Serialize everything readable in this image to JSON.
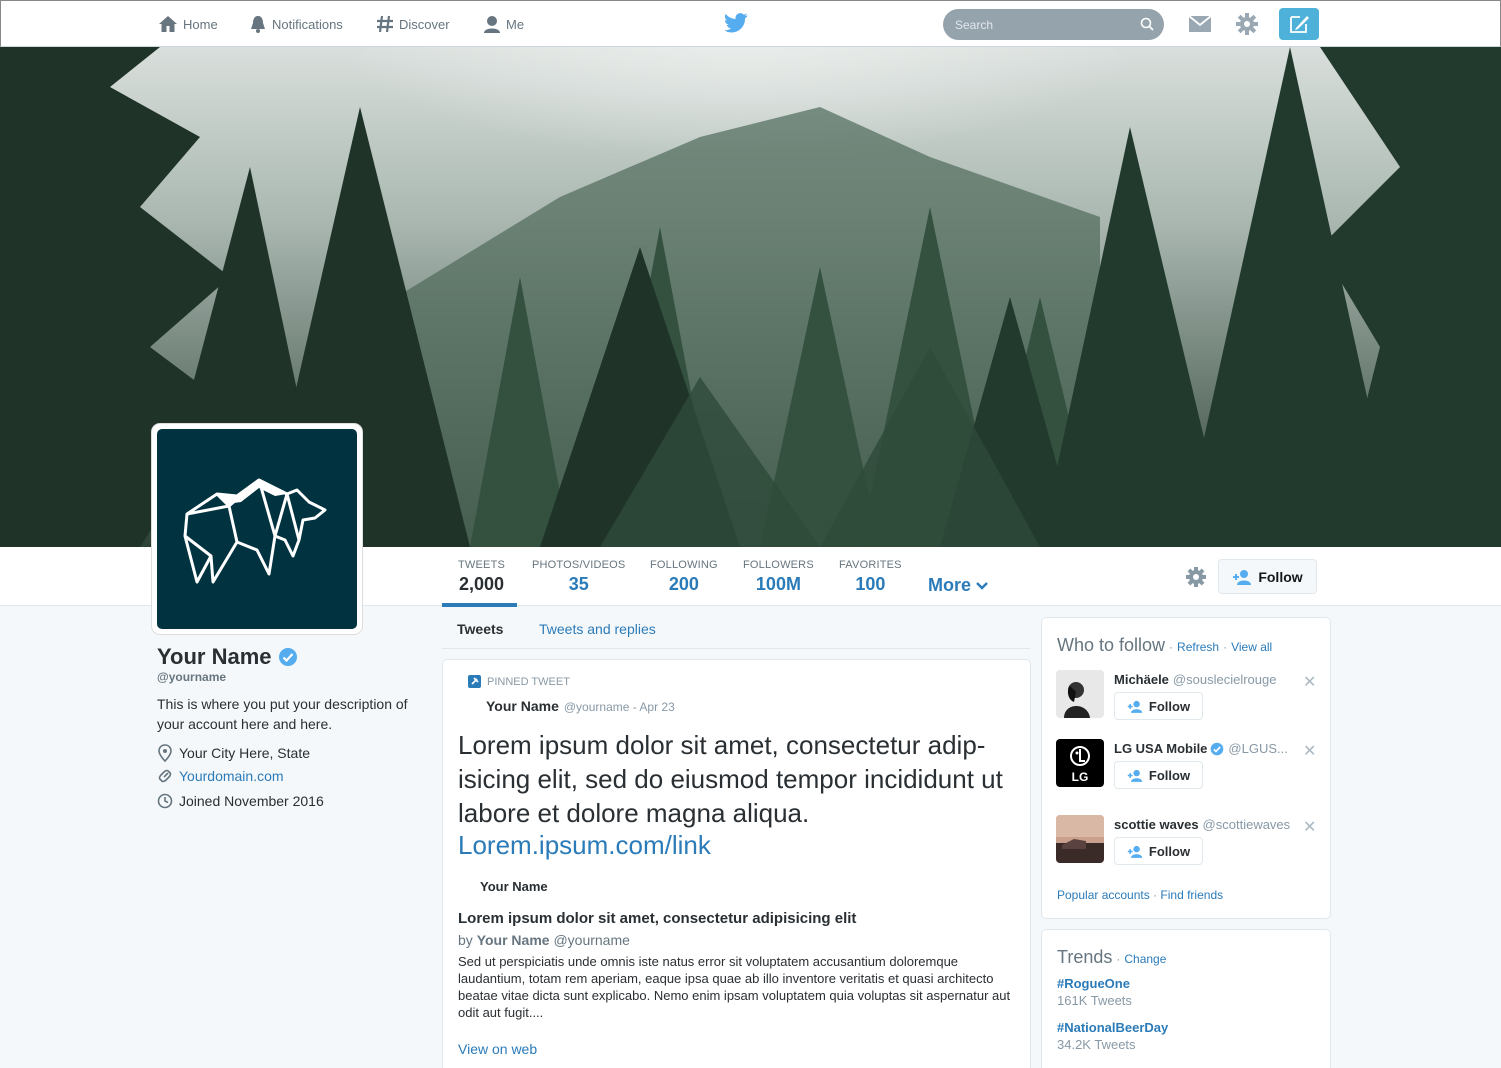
{
  "nav": {
    "home": "Home",
    "notifications": "Notifications",
    "discover": "Discover",
    "me": "Me",
    "search_placeholder": "Search"
  },
  "stats": [
    {
      "label": "TWEETS",
      "value": "2,000"
    },
    {
      "label": "PHOTOS/VIDEOS",
      "value": "35"
    },
    {
      "label": "FOLLOWING",
      "value": "200"
    },
    {
      "label": "FOLLOWERS",
      "value": "100M"
    },
    {
      "label": "FAVORITES",
      "value": "100"
    }
  ],
  "more_label": "More",
  "follow_label": "Follow",
  "profile": {
    "name": "Your Name",
    "handle": "@yourname",
    "description": "This is where you put your description of your account here and here.",
    "location": "Your City Here, State",
    "website": "Yourdomain.com",
    "joined": "Joined November 2016"
  },
  "tabs": {
    "tweets": "Tweets",
    "replies": "Tweets and replies"
  },
  "tweet": {
    "pinned_label": "PINNED TWEET",
    "author": "Your Name",
    "meta": "@yourname - Apr 23",
    "text": "Lorem ipsum dolor sit amet, consectetur adip-isicing elit, sed do eiusmod tempor incididunt ut labore et dolore magna aliqua.",
    "link": "Lorem.ipsum.com/link",
    "card_author": "Your Name",
    "card_title": "Lorem ipsum dolor sit amet, consectetur adipisicing elit",
    "card_by_prefix": "by",
    "card_by_name": "Your Name",
    "card_by_handle": "@yourname",
    "card_text": "Sed ut perspiciatis unde omnis iste natus error sit voluptatem accusantium doloremque laudantium, totam rem aperiam, eaque ipsa quae ab illo inventore veritatis et quasi architecto beatae vitae dicta sunt explicabo. Nemo enim ipsam voluptatem quia voluptas sit aspernatur aut odit aut fugit....",
    "view_on_web": "View on web"
  },
  "who_to_follow": {
    "title": "Who to follow",
    "refresh": "Refresh",
    "view_all": "View all",
    "suggestions": [
      {
        "name": "Michäele",
        "handle": "@souslecielrouge",
        "follow": "Follow",
        "verified": false
      },
      {
        "name": "LG USA Mobile",
        "handle": "@LGUS...",
        "follow": "Follow",
        "verified": true
      },
      {
        "name": "scottie waves",
        "handle": "@scottiewaves",
        "follow": "Follow",
        "verified": false
      }
    ],
    "popular": "Popular accounts",
    "find_friends": "Find friends"
  },
  "trends": {
    "title": "Trends",
    "change": "Change",
    "items": [
      {
        "tag": "#RogueOne",
        "count": "161K Tweets"
      },
      {
        "tag": "#NationalBeerDay",
        "count": "34.2K Tweets"
      }
    ]
  },
  "colors": {
    "accent": "#2b7bb9",
    "twitter_blue": "#55acee",
    "avatar_bg": "#00323f",
    "verified": "#55acee"
  }
}
